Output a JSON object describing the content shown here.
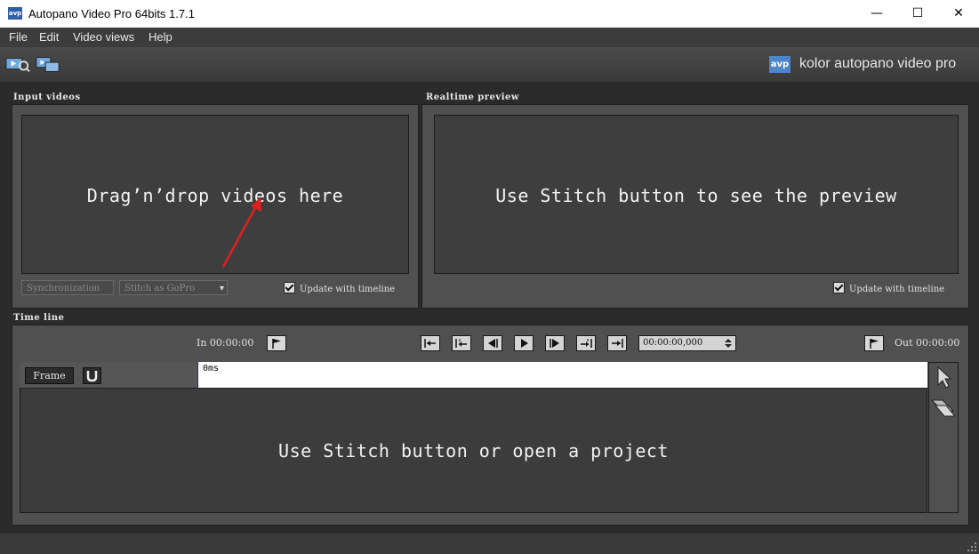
{
  "window": {
    "title": "Autopano Video Pro 64bits 1.7.1",
    "app_icon": "avp"
  },
  "menu": [
    "File",
    "Edit",
    "Video views",
    "Help"
  ],
  "brand": {
    "badge": "avp",
    "text": "kolor autopano video pro",
    "badge_color": "#4a86c8"
  },
  "input_videos": {
    "label": "Input videos",
    "dropzone_text": "Drag’n’drop videos here",
    "sync_button": "Synchronization",
    "stitch_button": "Stitch  as GoPro",
    "update_checkbox": "Update with timeline",
    "update_checked": true
  },
  "realtime_preview": {
    "label": "Realtime preview",
    "preview_text": "Use Stitch button to see the preview",
    "update_checkbox": "Update with timeline",
    "update_checked": true
  },
  "timeline": {
    "label": "Time line",
    "in_label": "In 00:00:00",
    "out_label": "Out 00:00:00",
    "timecode": "00:00:00,000",
    "frame_button": "Frame",
    "ruler_start": "0ms",
    "empty_text": "Use Stitch button or open a project"
  }
}
